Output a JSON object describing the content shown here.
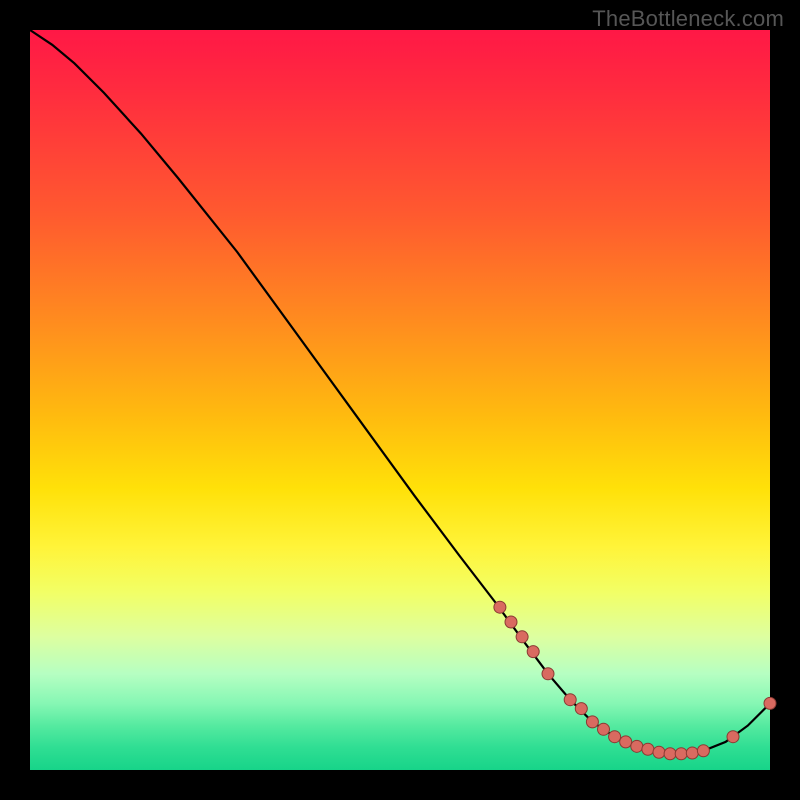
{
  "watermark": "TheBottleneck.com",
  "colors": {
    "point_fill": "#d96a60",
    "point_stroke": "#8a3a33",
    "curve": "#000000"
  },
  "chart_data": {
    "type": "line",
    "title": "",
    "xlabel": "",
    "ylabel": "",
    "xlim": [
      0,
      100
    ],
    "ylim": [
      0,
      100
    ],
    "grid": false,
    "legend": false,
    "series": [
      {
        "name": "curve",
        "x": [
          0,
          3,
          6,
          10,
          15,
          20,
          28,
          36,
          44,
          52,
          58,
          63,
          67,
          70,
          73,
          76,
          79,
          82,
          85,
          88,
          91,
          94,
          97,
          100
        ],
        "y": [
          100,
          98,
          95.5,
          91.5,
          86,
          80,
          70,
          59,
          48,
          37,
          29,
          22.5,
          17,
          13,
          9.5,
          6.5,
          4.5,
          3.2,
          2.4,
          2.2,
          2.6,
          3.8,
          6,
          9
        ]
      }
    ],
    "highlight_points": {
      "name": "markers",
      "x": [
        63.5,
        65,
        66.5,
        68,
        70,
        73,
        74.5,
        76,
        77.5,
        79,
        80.5,
        82,
        83.5,
        85,
        86.5,
        88,
        89.5,
        91,
        95,
        100
      ],
      "y": [
        22,
        20,
        18,
        16,
        13,
        9.5,
        8.3,
        6.5,
        5.5,
        4.5,
        3.8,
        3.2,
        2.8,
        2.4,
        2.2,
        2.2,
        2.3,
        2.6,
        4.5,
        9
      ]
    }
  }
}
